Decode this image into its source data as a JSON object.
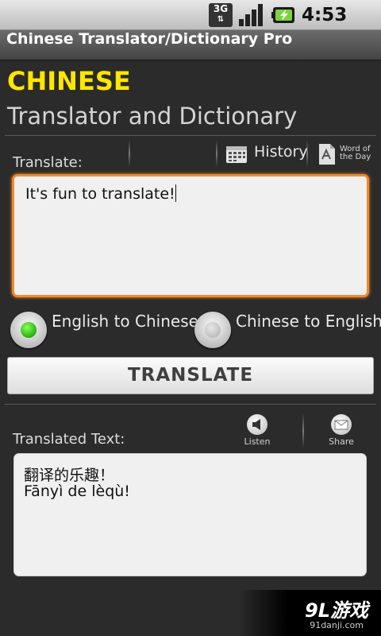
{
  "status_bar": {
    "network_type": "3G",
    "time": "4:53 AM"
  },
  "title_bar": {
    "title": "Chinese Translator/Dictionary Pro"
  },
  "header": {
    "app_name": "CHINESE",
    "subtitle": "Translator and Dictionary"
  },
  "translate_section": {
    "label": "Translate:",
    "history_label": "History",
    "word_of_day_line1": "Word of",
    "word_of_day_line2": "the Day",
    "input_value": "It's fun to translate!"
  },
  "direction": {
    "options": [
      {
        "label": "English to Chinese",
        "selected": true
      },
      {
        "label": "Chinese to English",
        "selected": false
      }
    ]
  },
  "translate_button": {
    "label": "TRANSLATE"
  },
  "output_section": {
    "label": "Translated Text:",
    "listen_label": "Listen",
    "share_label": "Share",
    "lines": [
      "翻译的乐趣！",
      "Fānyì de lèqù!"
    ]
  },
  "watermark": {
    "brand": "9L游戏",
    "url": "91danji.com"
  },
  "colors": {
    "accent": "#ffe600",
    "focus_border": "#ef8a2c",
    "radio_on": "#1dab0b",
    "background": "#2b2b2b"
  },
  "icons": {
    "history": "calendar-icon",
    "word_of_day": "dictionary-page-icon",
    "listen": "megaphone-icon",
    "share": "envelope-icon"
  }
}
